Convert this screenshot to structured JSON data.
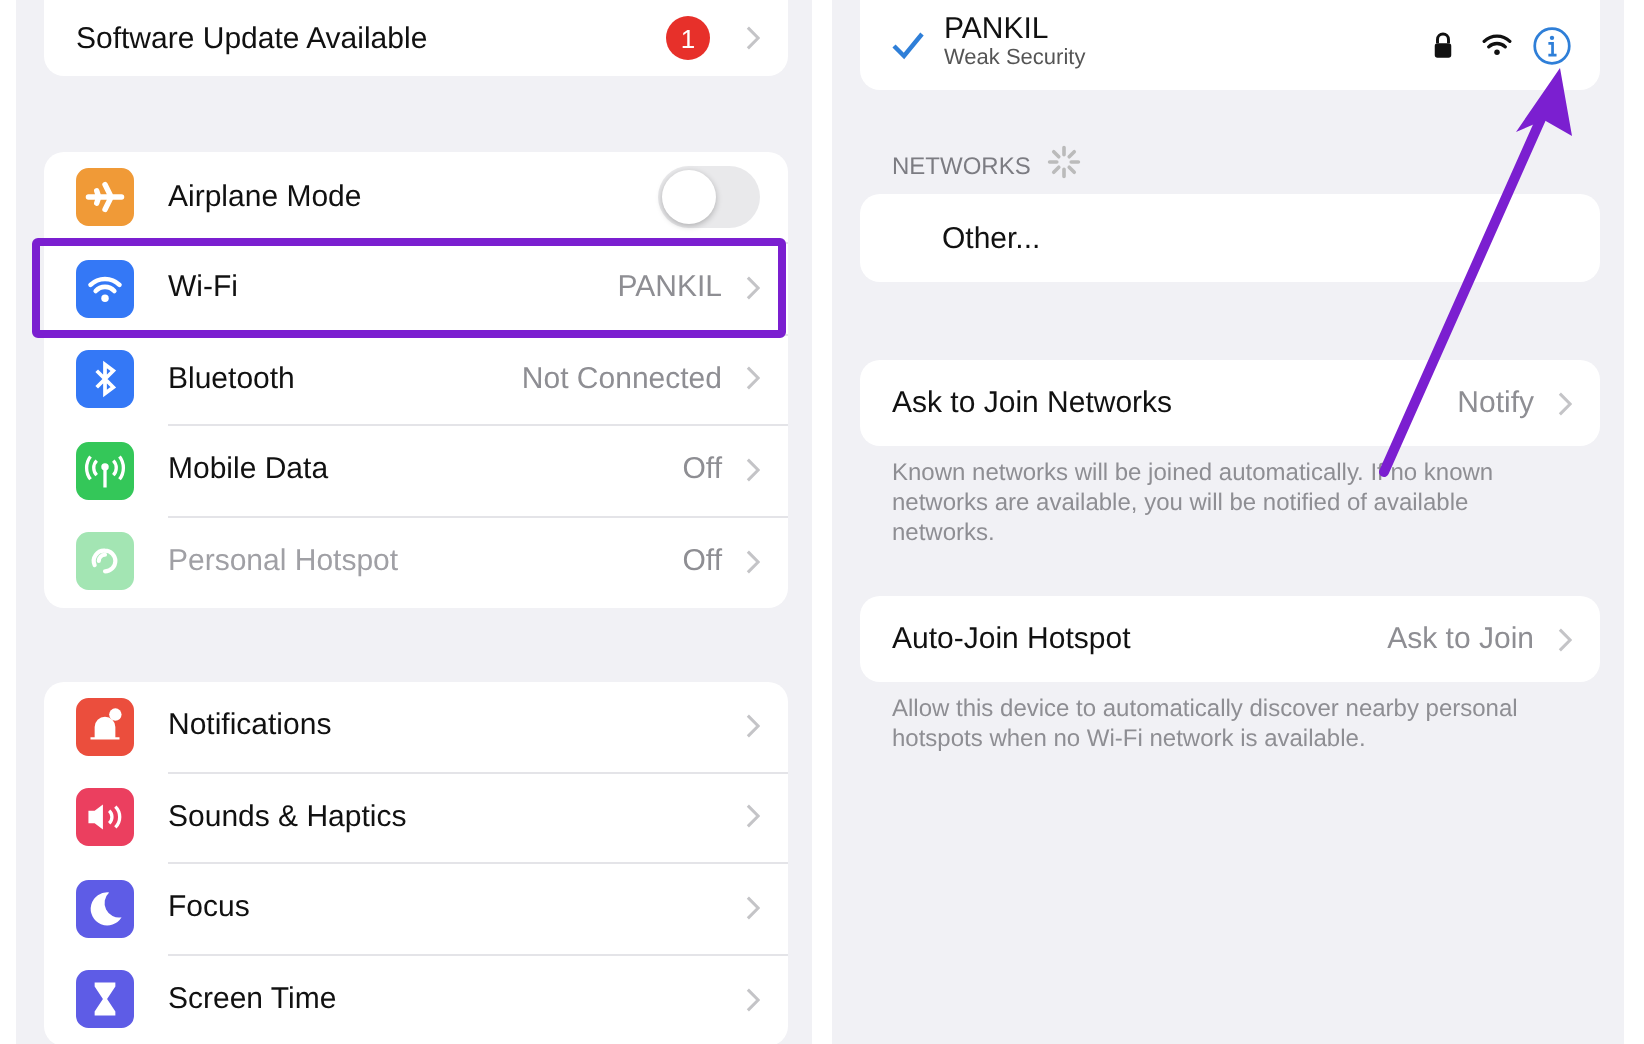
{
  "settings": {
    "software_update": {
      "label": "Software Update Available",
      "badge": "1"
    },
    "groups": [
      {
        "rows": [
          {
            "kind": "toggle",
            "label": "Airplane Mode",
            "on": false,
            "disabled": false,
            "highlighted": false
          },
          {
            "kind": "link",
            "label": "Wi-Fi",
            "value": "PANKIL",
            "disabled": false,
            "highlighted": true
          },
          {
            "kind": "link",
            "label": "Bluetooth",
            "value": "Not Connected",
            "disabled": false,
            "highlighted": false
          },
          {
            "kind": "link",
            "label": "Mobile Data",
            "value": "Off",
            "disabled": false,
            "highlighted": false
          },
          {
            "kind": "link",
            "label": "Personal Hotspot",
            "value": "Off",
            "disabled": true,
            "highlighted": false
          }
        ]
      },
      {
        "rows": [
          {
            "kind": "link",
            "label": "Notifications",
            "disabled": false,
            "highlighted": false
          },
          {
            "kind": "link",
            "label": "Sounds & Haptics",
            "disabled": false,
            "highlighted": false
          },
          {
            "kind": "link",
            "label": "Focus",
            "disabled": false,
            "highlighted": false
          },
          {
            "kind": "link",
            "label": "Screen Time",
            "disabled": false,
            "highlighted": false
          }
        ]
      }
    ]
  },
  "wifi": {
    "current_network": {
      "name": "PANKIL",
      "subtitle": "Weak Security",
      "checked": true
    },
    "networks_header": "NETWORKS",
    "other": "Other...",
    "options": [
      {
        "label": "Ask to Join Networks",
        "value": "Notify",
        "footnote": "Known networks will be joined automatically. If no known networks are available, you will be notified of available networks."
      },
      {
        "label": "Auto-Join Hotspot",
        "value": "Ask to Join",
        "footnote": "Allow this device to automatically discover nearby personal hotspots when no Wi-Fi network is available."
      }
    ]
  }
}
